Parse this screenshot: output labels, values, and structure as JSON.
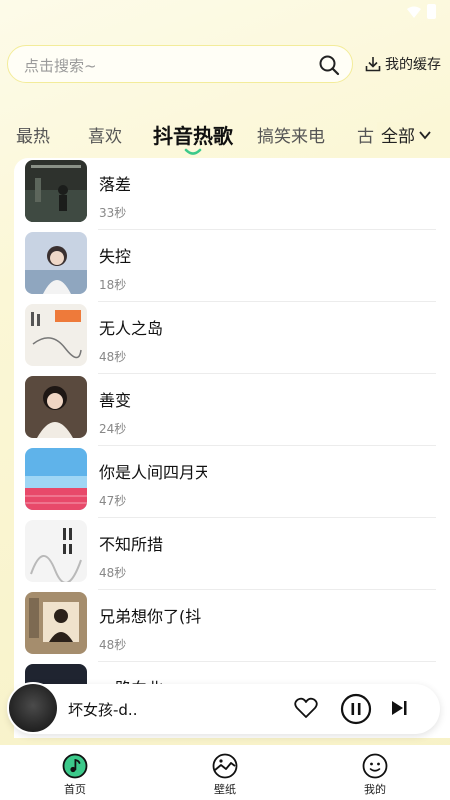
{
  "search": {
    "placeholder": "点击搜索~"
  },
  "header": {
    "cache_label": "我的缓存"
  },
  "tabs": {
    "items": [
      "最热",
      "喜欢",
      "抖音热歌",
      "搞笑来电",
      "古"
    ],
    "active": "抖音热歌",
    "all_label": "全部"
  },
  "songs": [
    {
      "title": "落差",
      "duration": "33秒"
    },
    {
      "title": "失控",
      "duration": "18秒"
    },
    {
      "title": "无人之岛",
      "duration": "48秒"
    },
    {
      "title": "善变",
      "duration": "24秒"
    },
    {
      "title": "你是人间四月天",
      "duration": "47秒"
    },
    {
      "title": "不知所措",
      "duration": "48秒"
    },
    {
      "title": "兄弟想你了(抖",
      "duration": "48秒"
    },
    {
      "title": "一路向北",
      "duration": ""
    }
  ],
  "player": {
    "title": "坏女孩-d.."
  },
  "bottom_nav": [
    {
      "label": "首页",
      "icon": "music-note-icon"
    },
    {
      "label": "壁纸",
      "icon": "wallpaper-icon"
    },
    {
      "label": "我的",
      "icon": "smiley-icon"
    }
  ],
  "colors": {
    "accent": "#3cc98a",
    "background": "#fbf7d6"
  }
}
